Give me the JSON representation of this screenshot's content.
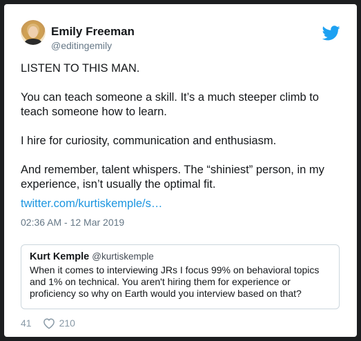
{
  "tweet": {
    "author_name": "Emily Freeman",
    "author_handle": "@editingemily",
    "paragraphs": [
      "LISTEN TO THIS MAN.",
      "You can teach someone a skill. It’s a much steeper climb to teach someone how to learn.",
      "I hire for curiosity, communication and enthusiasm.",
      "And remember, talent whispers. The “shiniest” person, in my experience, isn’t usually the optimal fit."
    ],
    "link_text": "twitter.com/kurtiskemple/s…",
    "timestamp": "02:36 AM - 12 Mar 2019",
    "retweet_count": "41",
    "like_count": "210"
  },
  "quoted_tweet": {
    "author_name": "Kurt Kemple",
    "author_handle": "@kurtiskemple",
    "text": "When it comes to interviewing JRs I focus 99% on behavioral topics and 1% on technical. You aren't hiring them for experience or proficiency so why on Earth would you interview based on that?"
  },
  "icons": {
    "brand": "twitter-bird-icon",
    "like": "heart-icon"
  },
  "colors": {
    "background": "#1c1e20",
    "card": "#ffffff",
    "twitter_blue": "#1da1f2",
    "link": "#1b95e0",
    "muted": "#657786"
  }
}
